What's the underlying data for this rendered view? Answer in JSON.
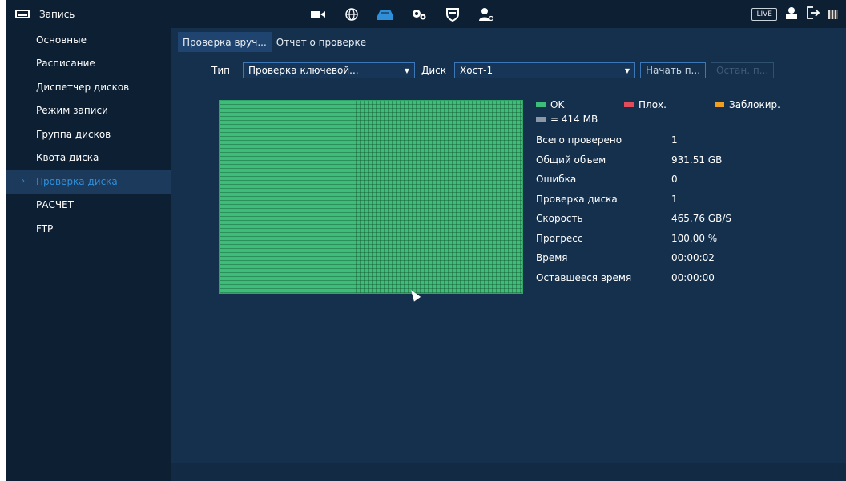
{
  "header": {
    "title": "Запись",
    "title_icon": "hdd-icon",
    "nav_icons": [
      "camera-icon",
      "network-icon",
      "storage-icon",
      "settings-icon",
      "security-icon",
      "account-icon"
    ],
    "live_label": "LIVE"
  },
  "sidebar": {
    "items": [
      {
        "label": "Основные"
      },
      {
        "label": "Расписание"
      },
      {
        "label": "Диспетчер дисков"
      },
      {
        "label": "Режим записи"
      },
      {
        "label": "Группа дисков"
      },
      {
        "label": "Квота диска"
      },
      {
        "label": "Проверка диска",
        "active": true
      },
      {
        "label": "РАСЧЕТ"
      },
      {
        "label": "FTP"
      }
    ]
  },
  "tabs": [
    {
      "label": "Проверка вруч...",
      "active": true
    },
    {
      "label": "Отчет о проверке"
    }
  ],
  "filters": {
    "type_label": "Тип",
    "type_value": "Проверка ключевой...",
    "disk_label": "Диск",
    "disk_value": "Хост-1",
    "start_button": "Начать п...",
    "stop_button": "Остан. п..."
  },
  "legend": {
    "ok": "OK",
    "bad": "Плох.",
    "locked": "Заблокир.",
    "block_size": "= 414 MB",
    "colors": {
      "ok": "#3dbd79",
      "bad": "#e04c5c",
      "locked": "#f0a020",
      "block": "#8a98a8"
    }
  },
  "stats": [
    {
      "label": "Всего проверено",
      "value": "1"
    },
    {
      "label": "Общий объем",
      "value": "931.51 GB"
    },
    {
      "label": "Ошибка",
      "value": "0"
    },
    {
      "label": "Проверка диска",
      "value": "1"
    },
    {
      "label": "Скорость",
      "value": "465.76 GB/S"
    },
    {
      "label": "Прогресс",
      "value": "100.00 %"
    },
    {
      "label": "Время",
      "value": "00:00:02"
    },
    {
      "label": "Оставшееся время",
      "value": "00:00:00"
    }
  ],
  "colors": {
    "accent": "#2f8fd9",
    "background": "#15304d",
    "panel": "#0d1f33"
  }
}
